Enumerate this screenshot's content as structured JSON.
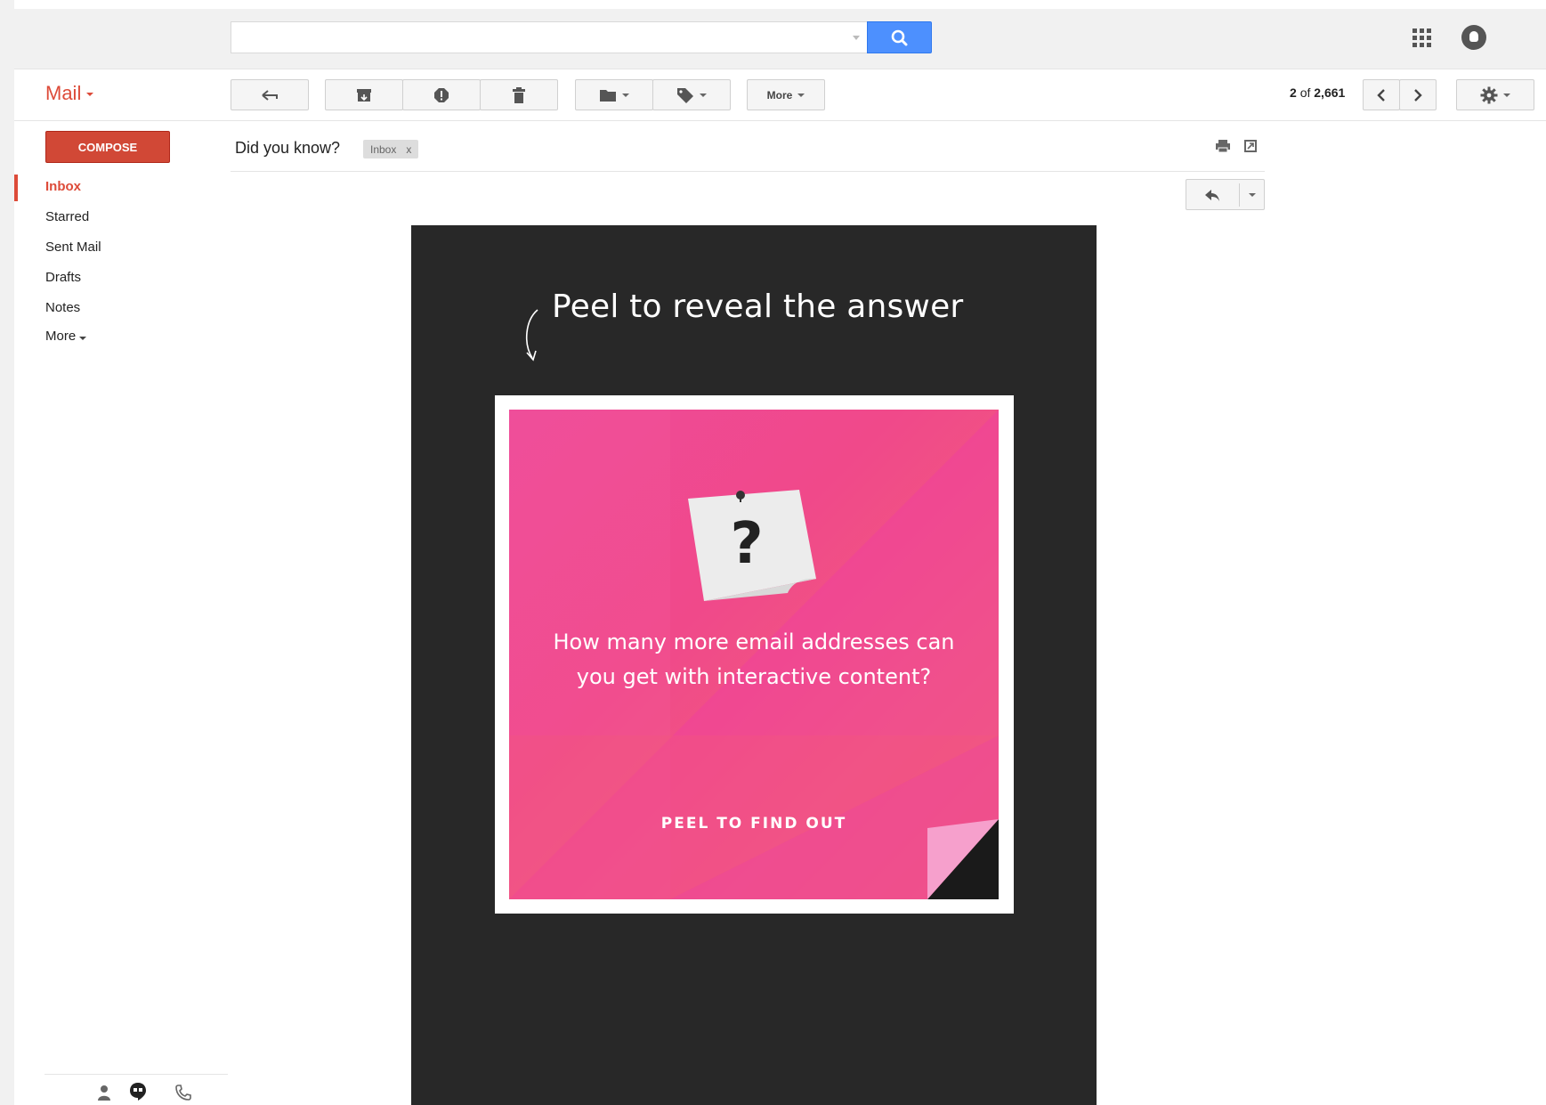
{
  "header": {
    "search_placeholder": "",
    "app_name": "Mail",
    "pagination": {
      "position_bold": "2",
      "of_label": "of",
      "total_bold": "2,661"
    }
  },
  "toolbar": {
    "more_label": "More"
  },
  "sidebar": {
    "compose_label": "COMPOSE",
    "items": [
      {
        "label": "Inbox",
        "active": true
      },
      {
        "label": "Starred",
        "active": false
      },
      {
        "label": "Sent Mail",
        "active": false
      },
      {
        "label": "Drafts",
        "active": false
      },
      {
        "label": "Notes",
        "active": false
      },
      {
        "label": "More",
        "active": false
      }
    ]
  },
  "message": {
    "subject": "Did you know?",
    "label_chip": "Inbox",
    "label_remove": "x",
    "email_content": {
      "headline": "Peel to reveal the answer",
      "question_line1": "How many more email addresses can",
      "question_line2": "you get with interactive content?",
      "cta": "PEEL TO FIND OUT"
    }
  },
  "colors": {
    "brand_red": "#dd4b39",
    "compose_red": "#d14836",
    "search_blue": "#4d90fe",
    "email_bg": "#282828",
    "card_pink": "#ee4a9a"
  }
}
